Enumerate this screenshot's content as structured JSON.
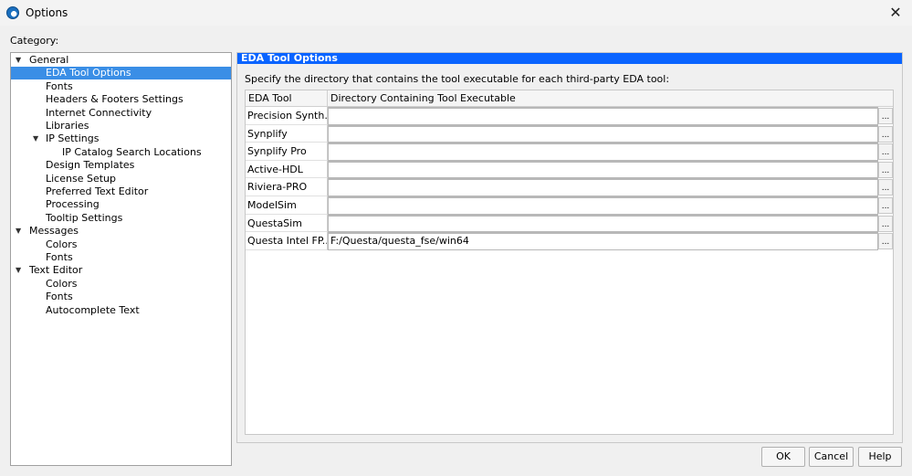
{
  "window": {
    "title": "Options",
    "close_icon": "close-icon"
  },
  "category_label": "Category:",
  "tree": [
    {
      "label": "General",
      "level": 0,
      "expanded": true
    },
    {
      "label": "EDA Tool Options",
      "level": 1,
      "selected": true
    },
    {
      "label": "Fonts",
      "level": 1
    },
    {
      "label": "Headers & Footers Settings",
      "level": 1
    },
    {
      "label": "Internet Connectivity",
      "level": 1
    },
    {
      "label": "Libraries",
      "level": 1
    },
    {
      "label": "IP Settings",
      "level": 1,
      "expanded": true
    },
    {
      "label": "IP Catalog Search Locations",
      "level": 2
    },
    {
      "label": "Design Templates",
      "level": 1
    },
    {
      "label": "License Setup",
      "level": 1
    },
    {
      "label": "Preferred Text Editor",
      "level": 1
    },
    {
      "label": "Processing",
      "level": 1
    },
    {
      "label": "Tooltip Settings",
      "level": 1
    },
    {
      "label": "Messages",
      "level": 0,
      "expanded": true
    },
    {
      "label": "Colors",
      "level": 1
    },
    {
      "label": "Fonts",
      "level": 1
    },
    {
      "label": "Text Editor",
      "level": 0,
      "expanded": true
    },
    {
      "label": "Colors",
      "level": 1
    },
    {
      "label": "Fonts",
      "level": 1
    },
    {
      "label": "Autocomplete Text",
      "level": 1
    }
  ],
  "panel": {
    "title": "EDA Tool Options",
    "description": "Specify the directory that contains the tool executable for each third-party EDA tool:",
    "columns": [
      "EDA Tool",
      "Directory Containing Tool Executable"
    ],
    "browse_label": "...",
    "rows": [
      {
        "tool": "Precision Synth...",
        "dir": ""
      },
      {
        "tool": "Synplify",
        "dir": ""
      },
      {
        "tool": "Synplify Pro",
        "dir": ""
      },
      {
        "tool": "Active-HDL",
        "dir": ""
      },
      {
        "tool": "Riviera-PRO",
        "dir": ""
      },
      {
        "tool": "ModelSim",
        "dir": ""
      },
      {
        "tool": "QuestaSim",
        "dir": ""
      },
      {
        "tool": "Questa Intel FP...",
        "dir": "F:/Questa/questa_fse/win64"
      }
    ]
  },
  "buttons": {
    "ok": "OK",
    "cancel": "Cancel",
    "help": "Help"
  },
  "colors": {
    "selection": "#3a8ee6",
    "panel_header": "#0a64ff"
  }
}
